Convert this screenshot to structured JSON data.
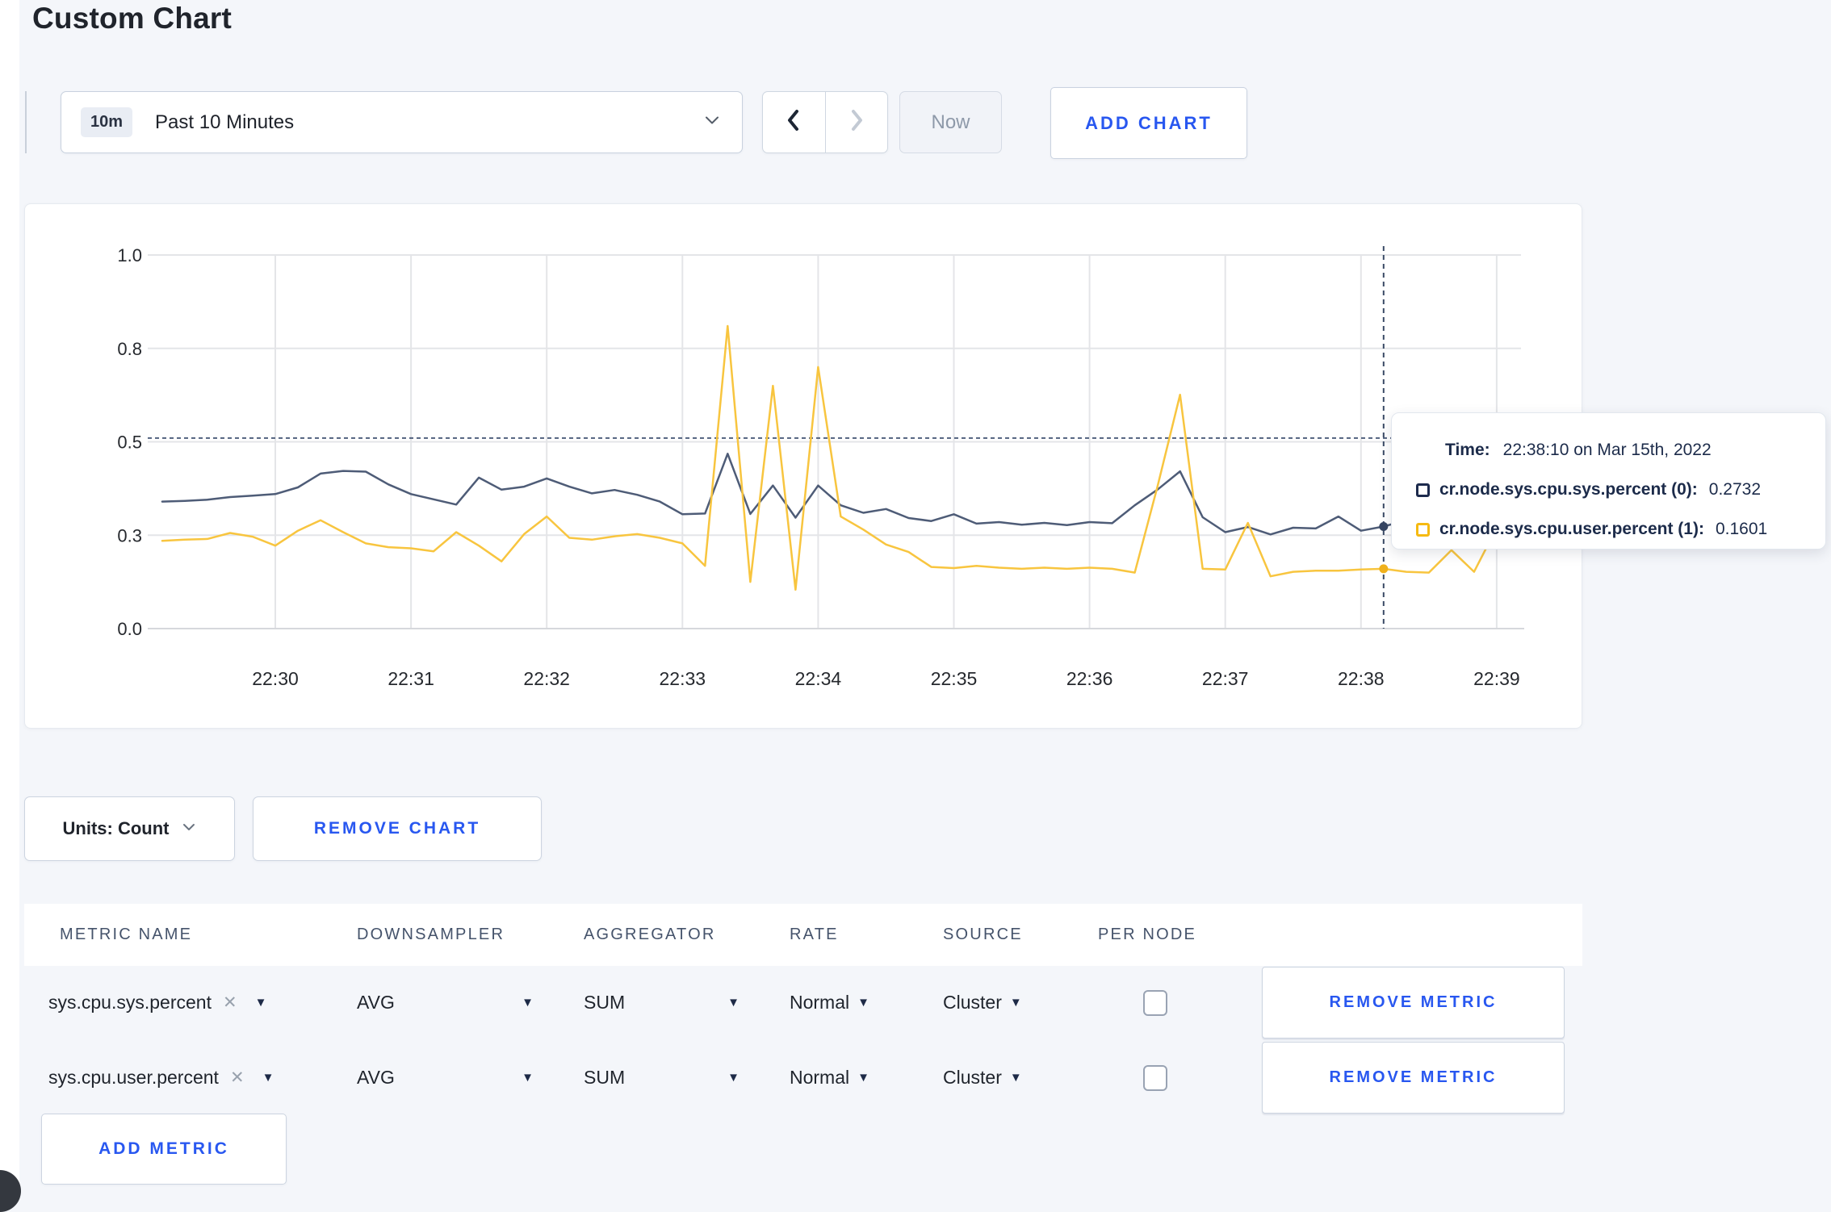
{
  "page": {
    "title": "Custom Chart"
  },
  "toolbar": {
    "time_badge": "10m",
    "time_label": "Past 10 Minutes",
    "now_label": "Now",
    "add_chart_label": "ADD CHART"
  },
  "chart_data": {
    "type": "line",
    "title": "",
    "xlabel": "",
    "ylabel": "",
    "ylim": [
      0,
      1
    ],
    "grid": true,
    "legend_position": "none",
    "x_start": "22:29:10",
    "x_step_seconds": 10,
    "x_tick_labels": [
      "22:30",
      "22:31",
      "22:32",
      "22:33",
      "22:34",
      "22:35",
      "22:36",
      "22:37",
      "22:38",
      "22:39"
    ],
    "y_ticks": [
      {
        "value": 0,
        "label": "0.0"
      },
      {
        "value": 0.25,
        "label": "0.3"
      },
      {
        "value": 0.5,
        "label": "0.5"
      },
      {
        "value": 0.75,
        "label": "0.8"
      },
      {
        "value": 1,
        "label": "1.0"
      }
    ],
    "guide_line_value": 0.51,
    "hover": {
      "index": 54,
      "time": "22:38:10"
    },
    "series": [
      {
        "name": "cr.node.sys.cpu.sys.percent",
        "color": "#4e5c77",
        "dot_color": "#364562",
        "values": [
          0.34,
          0.342,
          0.345,
          0.352,
          0.356,
          0.36,
          0.378,
          0.415,
          0.422,
          0.42,
          0.386,
          0.36,
          0.346,
          0.332,
          0.404,
          0.372,
          0.38,
          0.402,
          0.38,
          0.362,
          0.371,
          0.358,
          0.34,
          0.306,
          0.308,
          0.468,
          0.307,
          0.383,
          0.297,
          0.383,
          0.33,
          0.31,
          0.32,
          0.296,
          0.288,
          0.306,
          0.281,
          0.285,
          0.278,
          0.283,
          0.277,
          0.285,
          0.282,
          0.33,
          0.372,
          0.421,
          0.298,
          0.258,
          0.272,
          0.252,
          0.27,
          0.268,
          0.3,
          0.262,
          0.2732,
          0.29,
          0.275,
          0.27,
          0.272,
          0.27,
          0.272
        ]
      },
      {
        "name": "cr.node.sys.cpu.user.percent",
        "color": "#f8c53f",
        "dot_color": "#f0b11c",
        "values": [
          0.235,
          0.238,
          0.24,
          0.256,
          0.246,
          0.222,
          0.262,
          0.29,
          0.258,
          0.228,
          0.218,
          0.215,
          0.207,
          0.258,
          0.222,
          0.18,
          0.253,
          0.3,
          0.243,
          0.238,
          0.247,
          0.253,
          0.243,
          0.228,
          0.168,
          0.81,
          0.125,
          0.65,
          0.104,
          0.7,
          0.3,
          0.265,
          0.225,
          0.205,
          0.165,
          0.162,
          0.168,
          0.163,
          0.16,
          0.163,
          0.16,
          0.163,
          0.16,
          0.15,
          0.38,
          0.626,
          0.16,
          0.158,
          0.283,
          0.14,
          0.152,
          0.155,
          0.155,
          0.158,
          0.1601,
          0.152,
          0.15,
          0.21,
          0.152,
          0.27,
          0.23
        ]
      }
    ]
  },
  "tooltip": {
    "time_label": "Time:",
    "time_value": "22:38:10 on Mar 15th, 2022",
    "series": [
      {
        "name": "cr.node.sys.cpu.sys.percent (0):",
        "value": "0.2732",
        "color": "#1d2b4d"
      },
      {
        "name": "cr.node.sys.cpu.user.percent (1):",
        "value": "0.1601",
        "color": "#f6ba12"
      }
    ]
  },
  "units_row": {
    "units_label": "Units: Count",
    "remove_chart_label": "REMOVE CHART"
  },
  "table": {
    "headers": [
      "METRIC NAME",
      "DOWNSAMPLER",
      "AGGREGATOR",
      "RATE",
      "SOURCE",
      "PER NODE"
    ],
    "rows": [
      {
        "metric": "sys.cpu.sys.percent",
        "downsampler": "AVG",
        "aggregator": "SUM",
        "rate": "Normal",
        "source": "Cluster",
        "per_node_checked": false,
        "remove_label": "REMOVE METRIC"
      },
      {
        "metric": "sys.cpu.user.percent",
        "downsampler": "AVG",
        "aggregator": "SUM",
        "rate": "Normal",
        "source": "Cluster",
        "per_node_checked": false,
        "remove_label": "REMOVE METRIC"
      }
    ],
    "add_metric_label": "ADD METRIC"
  }
}
